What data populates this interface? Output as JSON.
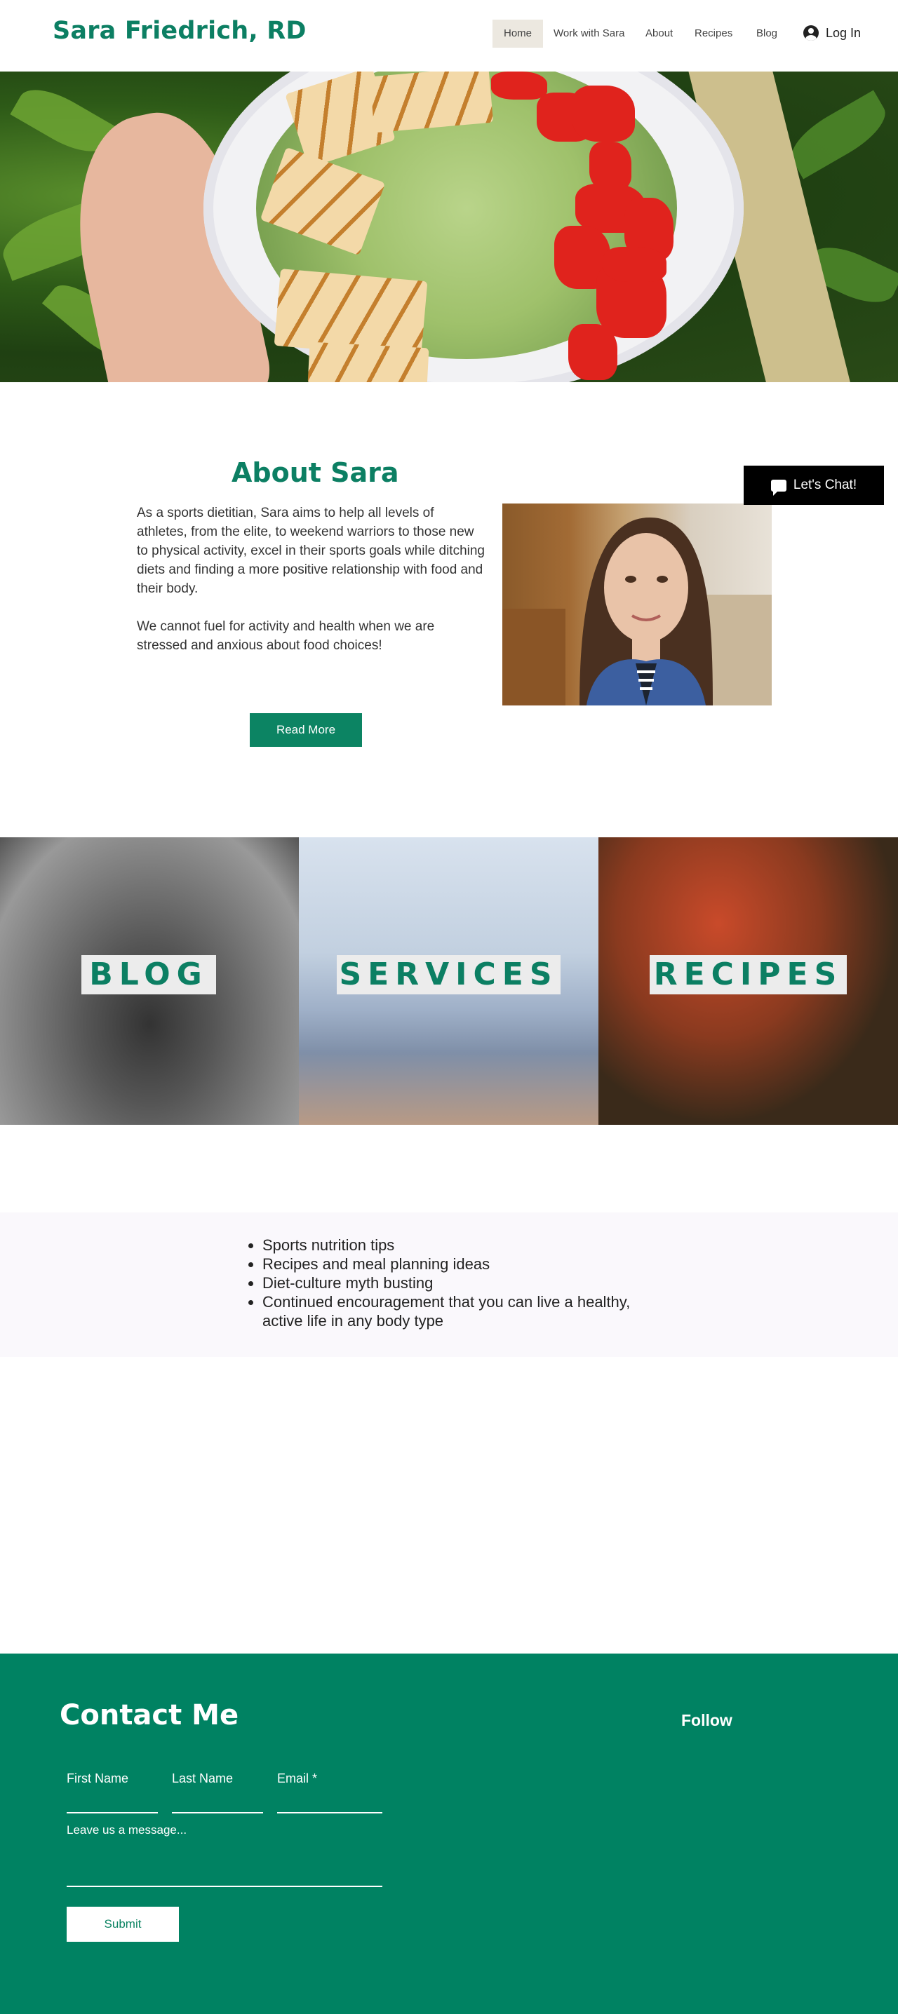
{
  "header": {
    "site_title": "Sara Friedrich, RD",
    "nav": [
      {
        "label": "Home",
        "active": true
      },
      {
        "label": "Work with Sara",
        "active": false
      },
      {
        "label": "About",
        "active": false
      },
      {
        "label": "Recipes",
        "active": false
      },
      {
        "label": "Blog",
        "active": false
      }
    ],
    "login_label": "Log In"
  },
  "about": {
    "title": "About Sara",
    "paragraph1": "As a sports dietitian, Sara aims to help all levels of athletes, from the elite, to weekend warriors to those new to physical activity, excel in their sports goals while ditching diets and finding a more positive relationship with food and their body.",
    "paragraph2": "We cannot fuel for activity and health when we are stressed and anxious about food choices!",
    "read_more": "Read More"
  },
  "chat": {
    "label": "Let's Chat!"
  },
  "tiles": [
    {
      "label": "BLOG"
    },
    {
      "label": "SERVICES"
    },
    {
      "label": "RECIPES"
    }
  ],
  "bullets": [
    "Sports nutrition tips",
    "Recipes and meal planning ideas",
    "Diet-culture myth busting",
    "Continued encouragement that you can live a healthy, active life in any body type"
  ],
  "contact": {
    "title": "Contact Me",
    "follow": "Follow",
    "first_name": "First Name",
    "last_name": "Last Name",
    "email": "Email *",
    "message": "Leave us a message...",
    "submit": "Submit"
  },
  "colors": {
    "brand_green": "#0c7f63",
    "footer_green": "#008262",
    "chat_black": "#000000"
  }
}
